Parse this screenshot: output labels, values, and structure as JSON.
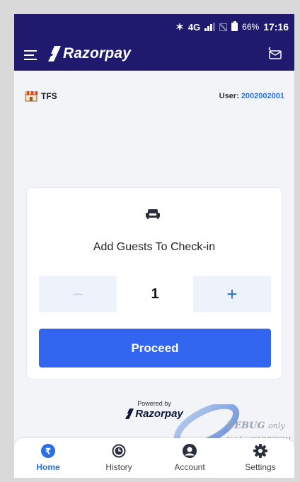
{
  "status_bar": {
    "network": "4G",
    "battery": "66%",
    "time": "17:16"
  },
  "header": {
    "brand": "Razorpay"
  },
  "info": {
    "store_name": "TFS",
    "user_label": "User:",
    "user_id": "2002002001"
  },
  "card": {
    "title": "Add Guests To Check-in",
    "minus_label": "−",
    "plus_label": "+",
    "guest_count": "1",
    "proceed_label": "Proceed"
  },
  "powered": {
    "text": "Powered by",
    "brand": "Razorpay"
  },
  "watermark": {
    "line1": "DEBUG",
    "line1_suffix": "only",
    "line2": "Not for COMMERCIAL"
  },
  "nav": {
    "items": [
      {
        "label": "Home",
        "icon": "rupee-icon",
        "active": true
      },
      {
        "label": "History",
        "icon": "history-icon",
        "active": false
      },
      {
        "label": "Account",
        "icon": "account-icon",
        "active": false
      },
      {
        "label": "Settings",
        "icon": "settings-icon",
        "active": false
      }
    ]
  },
  "colors": {
    "appbar": "#1f1a6e",
    "accent": "#3366f0",
    "link": "#2b6fe6"
  }
}
